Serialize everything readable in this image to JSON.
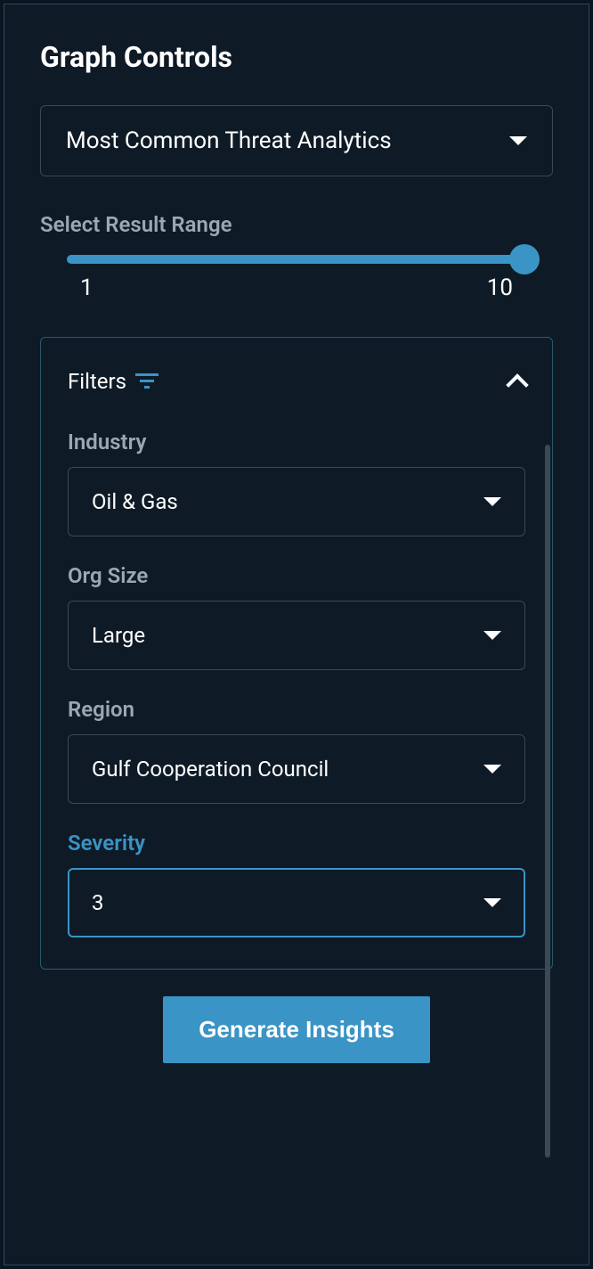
{
  "title": "Graph Controls",
  "mainSelect": {
    "value": "Most Common Threat Analytics"
  },
  "rangeSlider": {
    "label": "Select Result Range",
    "min": "1",
    "max": "10"
  },
  "filters": {
    "title": "Filters",
    "industry": {
      "label": "Industry",
      "value": "Oil & Gas"
    },
    "orgSize": {
      "label": "Org Size",
      "value": "Large"
    },
    "region": {
      "label": "Region",
      "value": "Gulf Cooperation Council"
    },
    "severity": {
      "label": "Severity",
      "value": "3"
    }
  },
  "generateButton": "Generate Insights",
  "colors": {
    "accent": "#3a94c5",
    "background": "#0e1a26",
    "border": "#3a4a55",
    "text": "#ffffff",
    "muted": "#9ba8b0"
  }
}
